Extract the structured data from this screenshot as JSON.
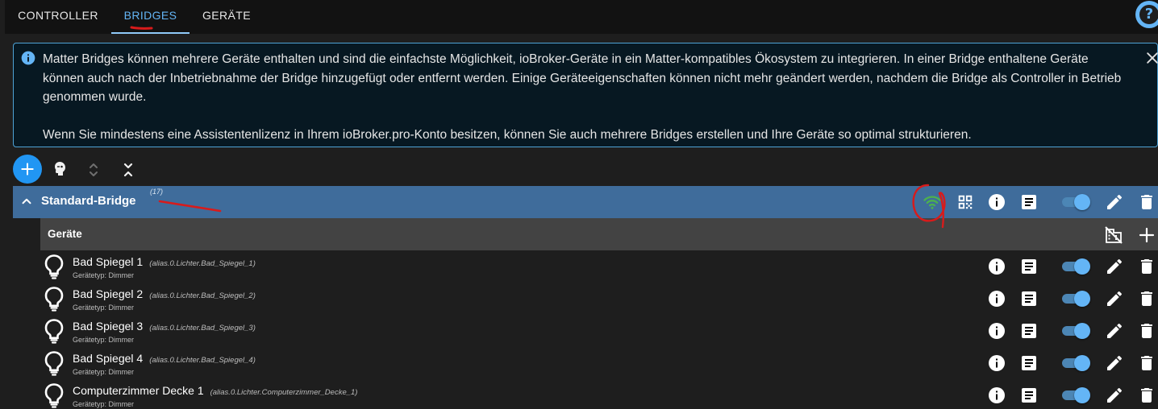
{
  "tabs": [
    {
      "label": "Controller",
      "active": false
    },
    {
      "label": "Bridges",
      "active": true
    },
    {
      "label": "Geräte",
      "active": false
    }
  ],
  "help": {
    "label": "?"
  },
  "alert": {
    "paragraph1": "Matter Bridges können mehrere Geräte enthalten und sind die einfachste Möglichkeit, ioBroker-Geräte in ein Matter-kompatibles Ökosystem zu integrieren. In einer Bridge enthaltene Geräte können auch nach der Inbetriebnahme der Bridge hinzugefügt oder entfernt werden. Einige Geräteeigenschaften können nicht mehr geändert werden, nachdem die Bridge als Controller in Betrieb genommen wurde.",
    "paragraph2": "Wenn Sie mindestens eine Assistentenlizenz in Ihrem ioBroker.pro-Konto besitzen, können Sie auch mehrere Bridges erstellen und Ihre Geräte so optimal strukturieren."
  },
  "bridge": {
    "title": "Standard-Bridge",
    "count": "(17)",
    "enabled": true
  },
  "devices_header": {
    "title": "Geräte"
  },
  "devices": [
    {
      "name": "Bad Spiegel 1",
      "id": "(alias.0.Lichter.Bad_Spiegel_1)",
      "type": "Gerätetyp: Dimmer",
      "enabled": true
    },
    {
      "name": "Bad Spiegel 2",
      "id": "(alias.0.Lichter.Bad_Spiegel_2)",
      "type": "Gerätetyp: Dimmer",
      "enabled": true
    },
    {
      "name": "Bad Spiegel 3",
      "id": "(alias.0.Lichter.Bad_Spiegel_3)",
      "type": "Gerätetyp: Dimmer",
      "enabled": true
    },
    {
      "name": "Bad Spiegel 4",
      "id": "(alias.0.Lichter.Bad_Spiegel_4)",
      "type": "Gerätetyp: Dimmer",
      "enabled": true
    },
    {
      "name": "Computerzimmer Decke 1",
      "id": "(alias.0.Lichter.Computerzimmer_Decke_1)",
      "type": "Gerätetyp: Dimmer",
      "enabled": true
    }
  ],
  "colors": {
    "accent": "#64b5f6",
    "bridge_header": "#3f6c9b",
    "devices_header": "#434343",
    "wifi_connected": "#4caf50",
    "annotation": "#d81b1b"
  },
  "icons": {
    "alert": "info-icon",
    "alert_close": "close-icon",
    "add": "plus-icon",
    "toolbar": [
      "robot-head-icon",
      "unfold-icon",
      "collapse-icon"
    ],
    "bridge": [
      "chevron-up-icon",
      "wifi-icon",
      "qr-code-icon",
      "info-icon",
      "log-icon",
      "toggle-switch",
      "edit-icon",
      "delete-icon"
    ],
    "devices_header": [
      "no-office-building-icon",
      "plus-icon"
    ],
    "device": [
      "lightbulb-icon",
      "info-icon",
      "log-icon",
      "toggle-switch",
      "edit-icon",
      "delete-icon"
    ]
  }
}
